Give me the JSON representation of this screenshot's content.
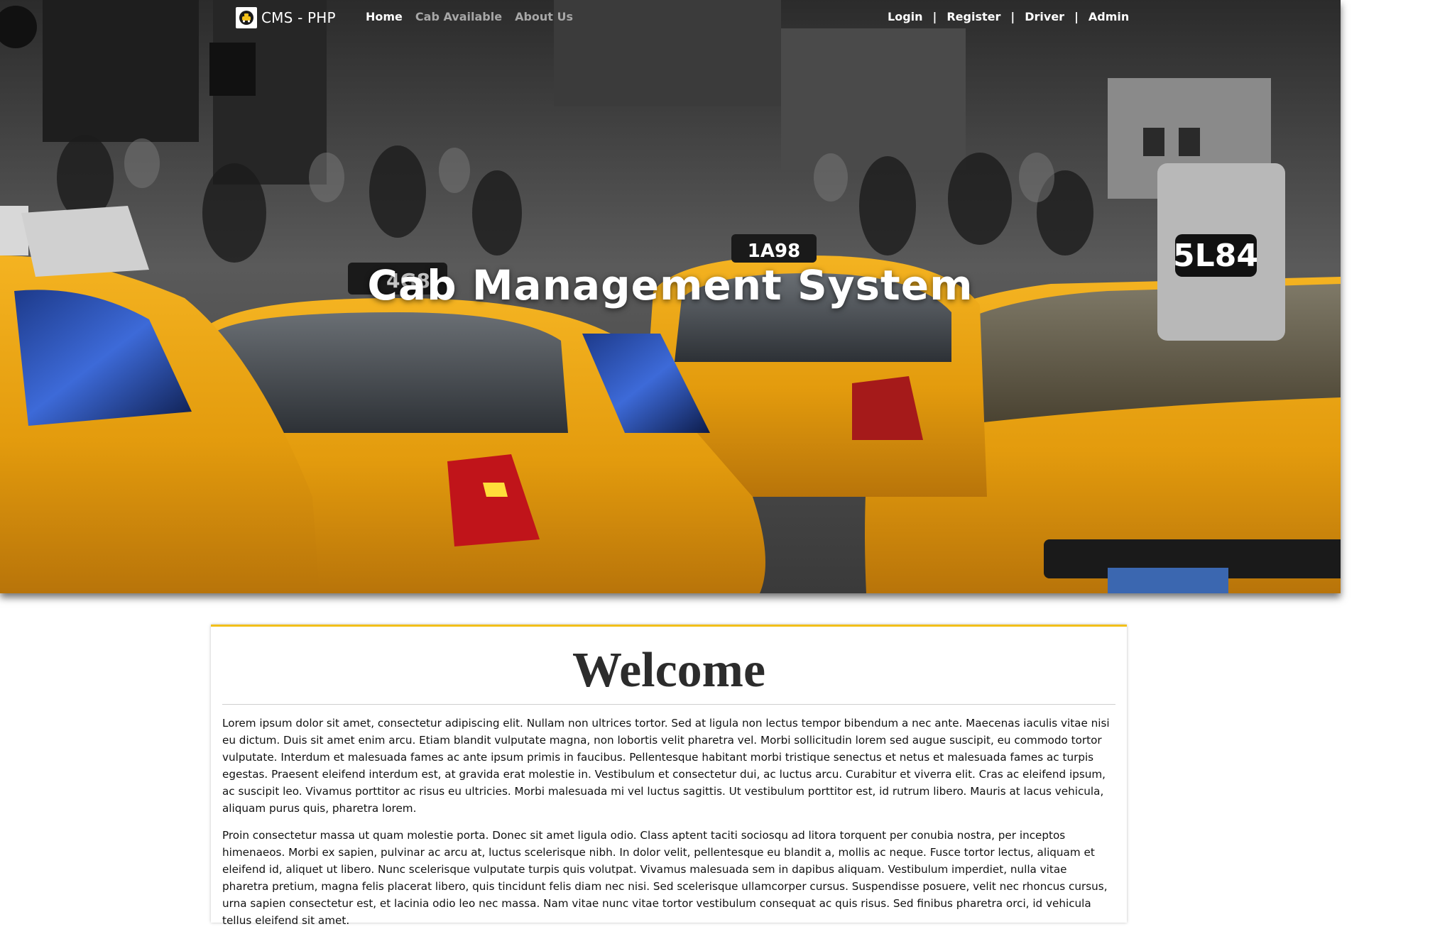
{
  "brand": {
    "name": "CMS - PHP",
    "logo_icon": "taxi-logo-icon"
  },
  "nav": {
    "left_links": [
      {
        "label": "Home",
        "active": true
      },
      {
        "label": "Cab Available",
        "active": false
      },
      {
        "label": "About Us",
        "active": false
      }
    ],
    "right_links": [
      {
        "label": "Login"
      },
      {
        "label": "Register"
      },
      {
        "label": "Driver"
      },
      {
        "label": "Admin"
      }
    ],
    "separator": "|"
  },
  "hero": {
    "title": "Cab Management System",
    "license_plates": [
      "1A98",
      "5L84",
      "4G8"
    ]
  },
  "welcome": {
    "heading": "Welcome",
    "paragraphs": [
      "Lorem ipsum dolor sit amet, consectetur adipiscing elit. Nullam non ultrices tortor. Sed at ligula non lectus tempor bibendum a nec ante. Maecenas iaculis vitae nisi eu dictum. Duis sit amet enim arcu. Etiam blandit vulputate magna, non lobortis velit pharetra vel. Morbi sollicitudin lorem sed augue suscipit, eu commodo tortor vulputate. Interdum et malesuada fames ac ante ipsum primis in faucibus. Pellentesque habitant morbi tristique senectus et netus et malesuada fames ac turpis egestas. Praesent eleifend interdum est, at gravida erat molestie in. Vestibulum et consectetur dui, ac luctus arcu. Curabitur et viverra elit. Cras ac eleifend ipsum, ac suscipit leo. Vivamus porttitor ac risus eu ultricies. Morbi malesuada mi vel luctus sagittis. Ut vestibulum porttitor est, id rutrum libero. Mauris at lacus vehicula, aliquam purus quis, pharetra lorem.",
      "Proin consectetur massa ut quam molestie porta. Donec sit amet ligula odio. Class aptent taciti sociosqu ad litora torquent per conubia nostra, per inceptos himenaeos. Morbi ex sapien, pulvinar ac arcu at, luctus scelerisque nibh. In dolor velit, pellentesque eu blandit a, mollis ac neque. Fusce tortor lectus, aliquam et eleifend id, aliquet ut libero. Nunc scelerisque vulputate turpis quis volutpat. Vivamus malesuada sem in dapibus aliquam. Vestibulum imperdiet, nulla vitae pharetra pretium, magna felis placerat libero, quis tincidunt felis diam nec nisi. Sed scelerisque ullamcorper cursus. Suspendisse posuere, velit nec rhoncus cursus, urna sapien consectetur est, et lacinia odio leo nec massa. Nam vitae nunc vitae tortor vestibulum consequat ac quis risus. Sed finibus pharetra orci, id vehicula tellus eleifend sit amet."
    ]
  },
  "colors": {
    "accent": "#f2c01a",
    "taxi_yellow": "#e8a50f",
    "nav_inactive": "#a7a7a7"
  }
}
